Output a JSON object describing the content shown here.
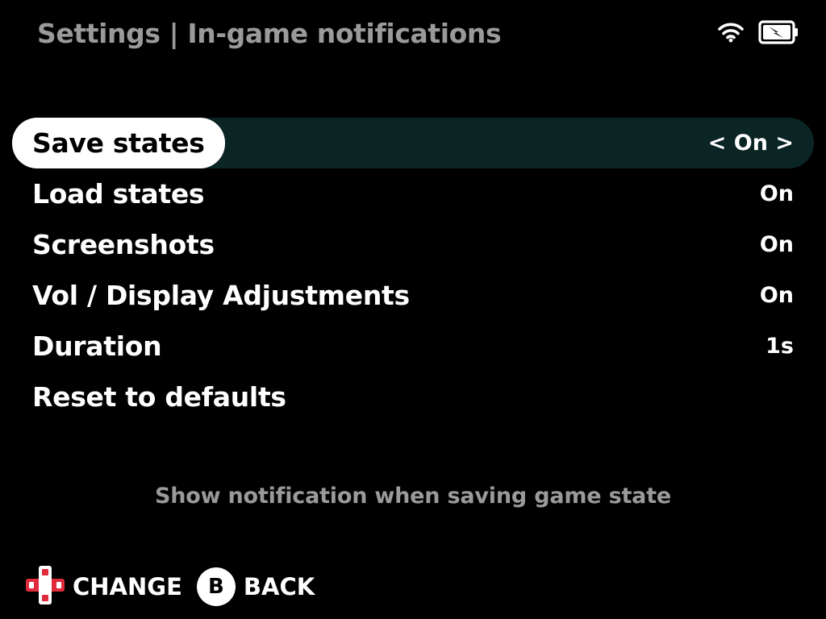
{
  "header": {
    "title": "Settings | In-game notifications",
    "status_icons": [
      "wifi-icon",
      "battery-charging-icon"
    ]
  },
  "menu": {
    "items": [
      {
        "label": "Save states",
        "value": "< On >",
        "selected": true
      },
      {
        "label": "Load states",
        "value": "On"
      },
      {
        "label": "Screenshots",
        "value": "On"
      },
      {
        "label": "Vol / Display Adjustments",
        "value": "On"
      },
      {
        "label": "Duration",
        "value": "1s"
      },
      {
        "label": "Reset to defaults",
        "value": ""
      }
    ]
  },
  "description": "Show notification when saving game state",
  "footer": {
    "change_label": "CHANGE",
    "b_glyph": "B",
    "back_label": "BACK"
  },
  "colors": {
    "background": "#000000",
    "selected_row_bg": "#0b2424",
    "title_gray": "#9a9a9a",
    "dpad_red": "#e02b3c"
  }
}
